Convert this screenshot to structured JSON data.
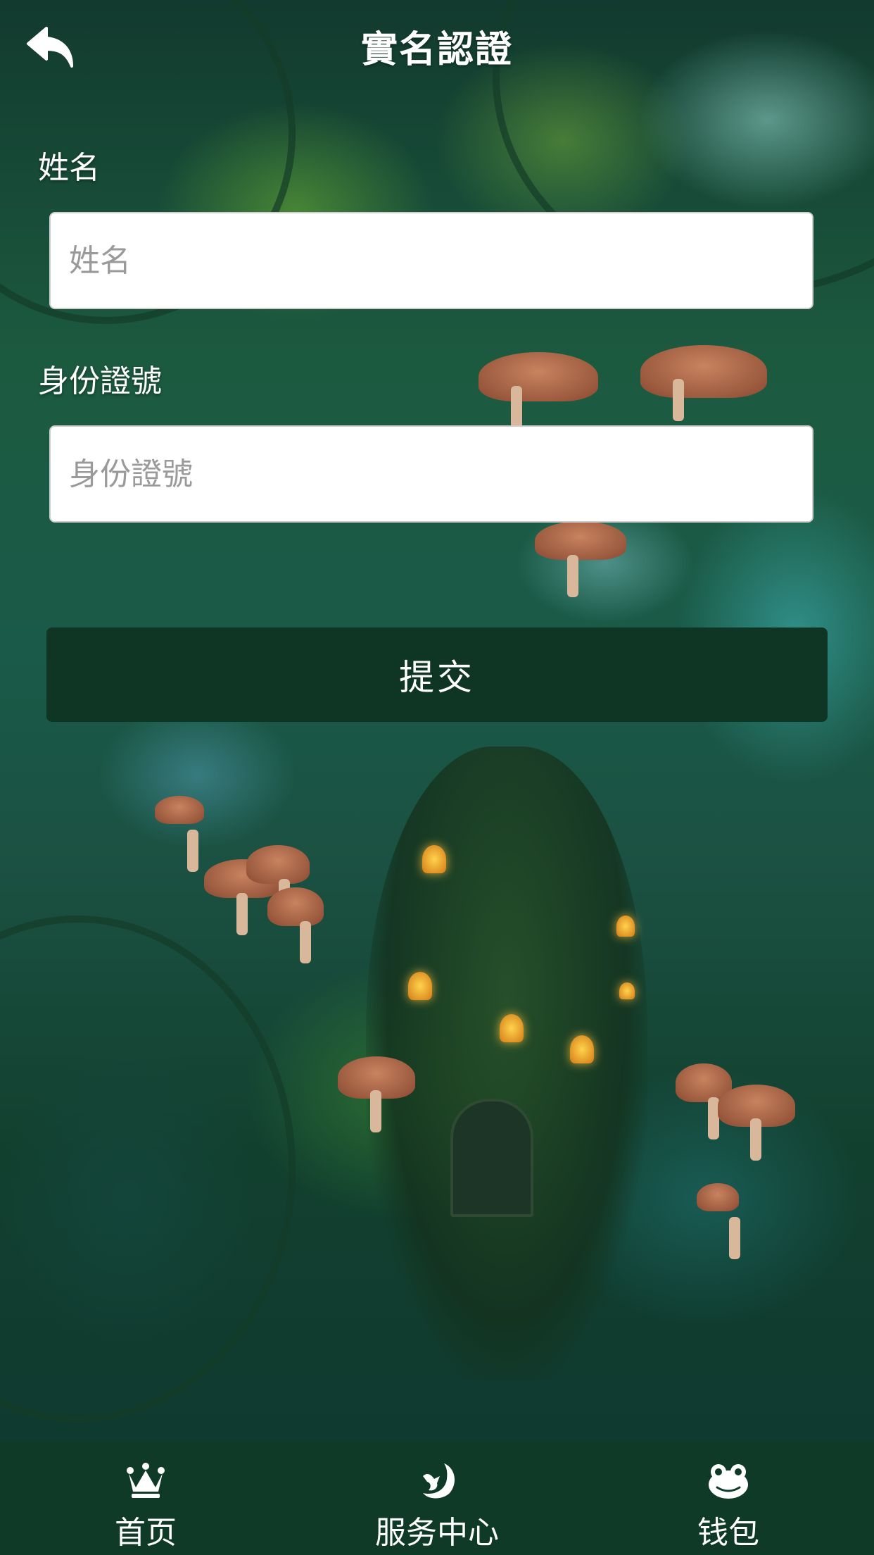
{
  "header": {
    "title": "實名認證",
    "back_icon": "back-arrow-icon"
  },
  "form": {
    "name_label": "姓名",
    "name_placeholder": "姓名",
    "name_value": "",
    "id_label": "身份證號",
    "id_placeholder": "身份證號",
    "id_value": "",
    "submit_label": "提交"
  },
  "tabbar": {
    "items": [
      {
        "label": "首页",
        "icon": "crown-icon"
      },
      {
        "label": "服务中心",
        "icon": "bird-moon-icon"
      },
      {
        "label": "钱包",
        "icon": "frog-icon"
      }
    ]
  },
  "colors": {
    "tabbar_bg": "#0f3a28",
    "submit_bg": "#0f3524",
    "text": "#ffffff",
    "input_bg": "#ffffff",
    "placeholder": "#9a9a9a"
  }
}
